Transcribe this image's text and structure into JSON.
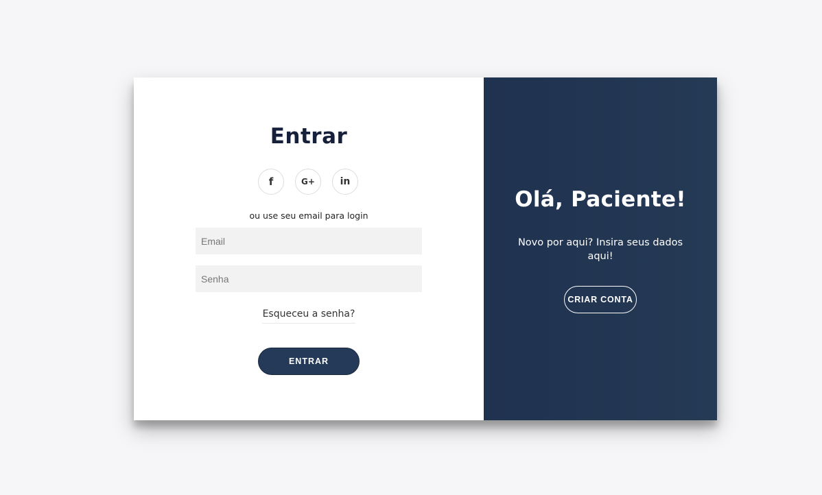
{
  "signin": {
    "title": "Entrar",
    "social": {
      "facebook_glyph": "f",
      "google_glyph": "G+",
      "linkedin_glyph": "in",
      "icons": [
        "facebook-icon",
        "google-plus-icon",
        "linkedin-icon"
      ]
    },
    "subtitle": "ou use seu email para login",
    "email_placeholder": "Email",
    "email_value": "",
    "password_placeholder": "Senha",
    "password_value": "",
    "forgot_label": "Esqueceu a senha?",
    "submit_label": "ENTRAR"
  },
  "overlay": {
    "title": "Olá, Paciente!",
    "text": "Novo por aqui? Insira seus dados aqui!",
    "button_label": "CRIAR CONTA"
  },
  "colors": {
    "background": "#f6f6f8",
    "panel_dark": "#223651",
    "title_dark": "#16203a",
    "input_bg": "#f2f2f2"
  }
}
